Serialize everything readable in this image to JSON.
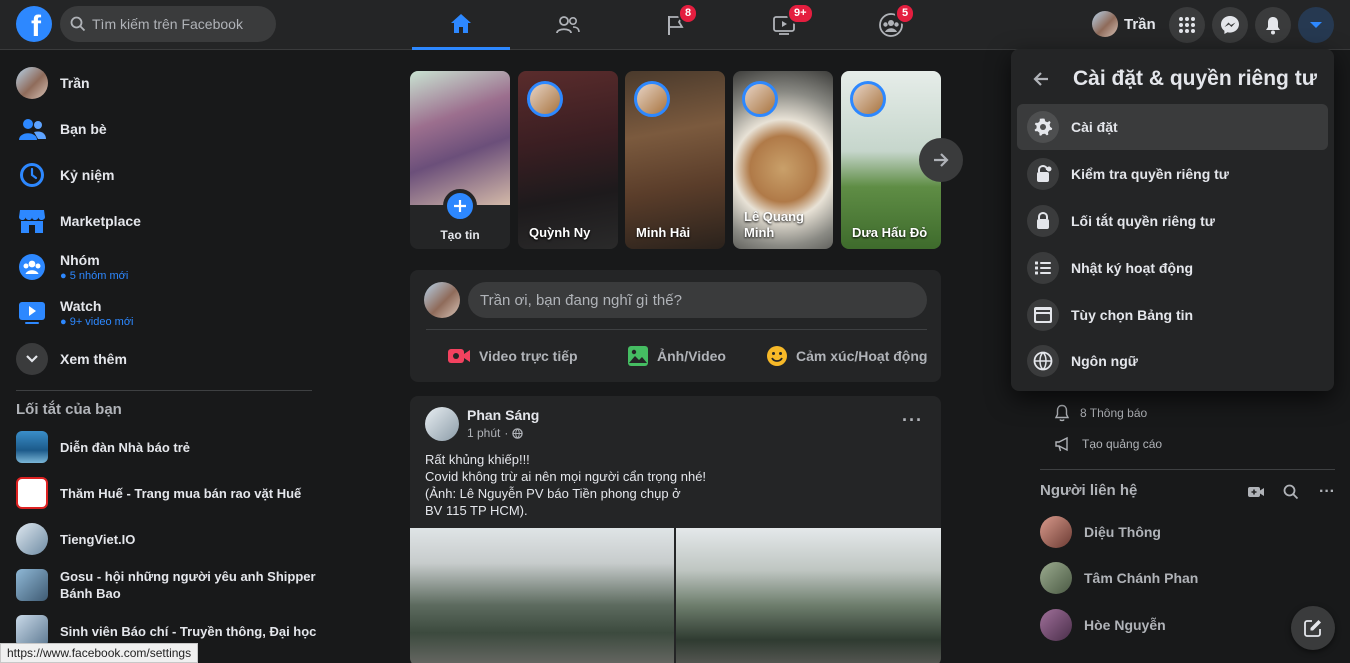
{
  "header": {
    "logo_letter": "f",
    "search_placeholder": "Tìm kiếm trên Facebook",
    "badges": {
      "pages": "8",
      "watch": "9+",
      "groups": "5"
    },
    "profile_name": "Trần"
  },
  "sidebar": {
    "profile_name": "Trần",
    "items": [
      {
        "label": "Bạn bè"
      },
      {
        "label": "Kỷ niệm"
      },
      {
        "label": "Marketplace"
      },
      {
        "label": "Nhóm",
        "sub": "5 nhóm mới"
      },
      {
        "label": "Watch",
        "sub": "9+ video mới"
      },
      {
        "label": "Xem thêm"
      }
    ],
    "shortcuts_title": "Lối tắt của bạn",
    "shortcuts": [
      "Diễn đàn Nhà báo trẻ",
      "Thăm Huế - Trang mua bán rao vặt Huế",
      "TiengViet.IO",
      "Gosu - hội những người yêu anh Shipper Bánh Bao",
      "Sinh viên Báo chí - Truyền thông, Đại học"
    ]
  },
  "stories": {
    "create_label": "Tạo tin",
    "items": [
      "Quỳnh Ny",
      "Minh Hải",
      "Lê Quang Minh",
      "Dưa Hấu Đỏ"
    ]
  },
  "composer": {
    "placeholder": "Trần ơi, bạn đang nghĩ gì thế?",
    "live": "Video trực tiếp",
    "photo": "Ảnh/Video",
    "feeling": "Cảm xúc/Hoạt động"
  },
  "post": {
    "author": "Phan Sáng",
    "time": "1 phút",
    "more": "···",
    "lines": [
      "Rất khủng khiếp!!!",
      "Covid không trừ ai nên mọi người cẩn trọng nhé!",
      "(Ảnh: Lê Nguyễn PV báo Tiền phong chụp ở",
      "BV 115 TP HCM)."
    ]
  },
  "right": {
    "notifications": "8 Thông báo",
    "create_ad": "Tạo quảng cáo",
    "contacts_title": "Người liên hệ",
    "contacts": [
      "Diệu Thông",
      "Tâm Chánh Phan",
      "Hòe Nguyễn"
    ]
  },
  "dropdown": {
    "title": "Cài đặt & quyền riêng tư",
    "items": [
      "Cài đặt",
      "Kiểm tra quyền riêng tư",
      "Lối tắt quyền riêng tư",
      "Nhật ký hoạt động",
      "Tùy chọn Bảng tin",
      "Ngôn ngữ"
    ]
  },
  "statusbar": {
    "url": "https://www.facebook.com/settings"
  },
  "colors": {
    "accent": "#2d88ff",
    "badge": "#e41e3f",
    "surface": "#242526",
    "background": "#18191a"
  }
}
